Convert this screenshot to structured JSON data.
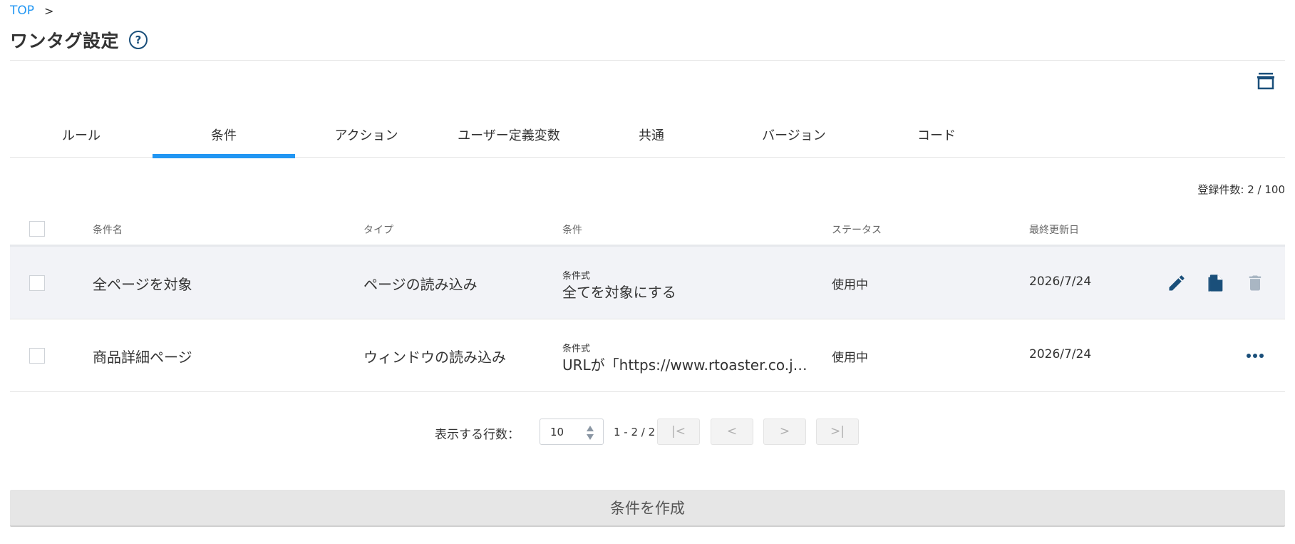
{
  "breadcrumb": {
    "top_label": "TOP",
    "separator": ">"
  },
  "page": {
    "title": "ワンタグ設定",
    "help_glyph": "?"
  },
  "tabs": [
    {
      "label": "ルール",
      "active": false
    },
    {
      "label": "条件",
      "active": true
    },
    {
      "label": "アクション",
      "active": false
    },
    {
      "label": "ユーザー定義変数",
      "active": false
    },
    {
      "label": "共通",
      "active": false
    },
    {
      "label": "バージョン",
      "active": false
    },
    {
      "label": "コード",
      "active": false
    }
  ],
  "count": {
    "text": "登録件数: 2 / 100"
  },
  "table": {
    "headers": {
      "name": "条件名",
      "type": "タイプ",
      "condition": "条件",
      "status": "ステータス",
      "updated": "最終更新日"
    },
    "rows": [
      {
        "name": "全ページを対象",
        "type": "ページの読み込み",
        "cond_label": "条件式",
        "cond_value": "全てを対象にする",
        "status": "使用中",
        "updated": "2026/7/24"
      },
      {
        "name": "商品詳細ページ",
        "type": "ウィンドウの読み込み",
        "cond_label": "条件式",
        "cond_value": "URLが「https://www.rtoaster.co.jp/…",
        "status": "使用中",
        "updated": "2026/7/24"
      }
    ]
  },
  "pager": {
    "label": "表示する行数：",
    "rows_value": "10",
    "range": "1 - 2 / 2",
    "first": "|<",
    "prev": "<",
    "next": ">",
    "last": ">|"
  },
  "create_button": {
    "label": "条件を作成"
  },
  "colors": {
    "accent": "#2196f3",
    "icon_dark": "#1a4f7a",
    "row_highlight": "#f2f3f7"
  }
}
